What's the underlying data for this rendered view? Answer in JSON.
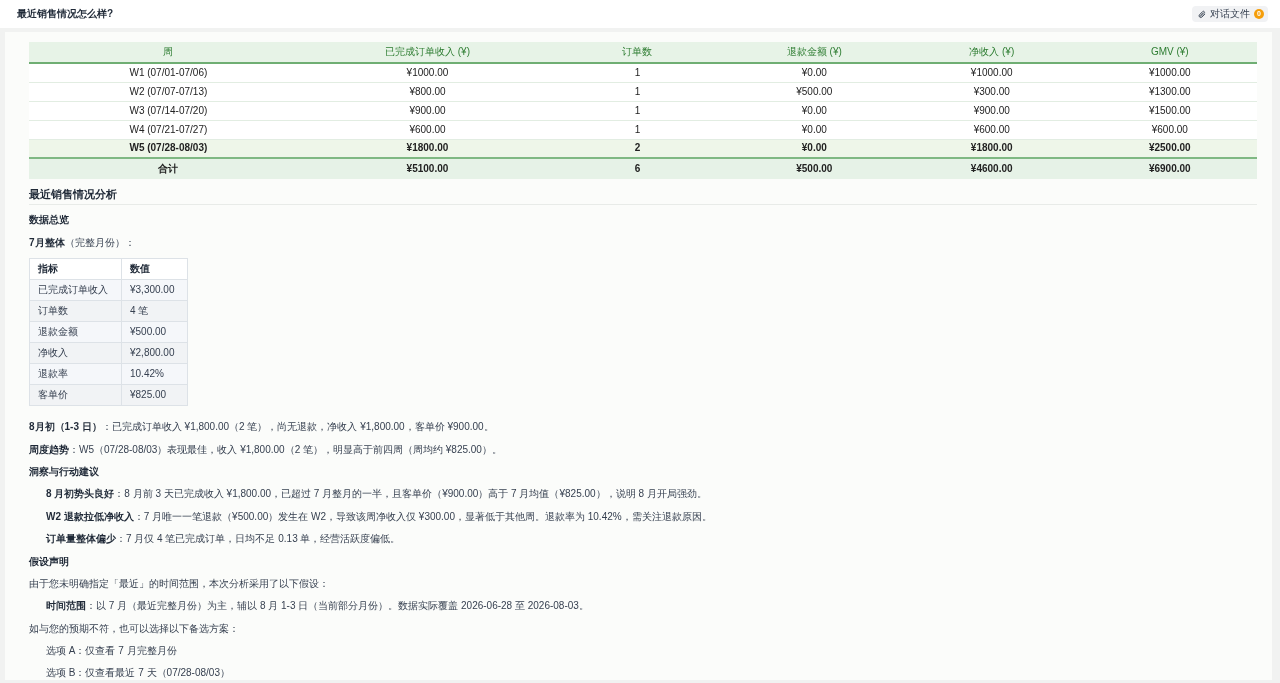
{
  "header": {
    "title": "最近销售情况怎么样?",
    "files_button": {
      "label": "对话文件",
      "count": "0"
    }
  },
  "sales_table": {
    "columns": [
      "周",
      "已完成订单收入 (¥)",
      "订单数",
      "退款金额 (¥)",
      "净收入 (¥)",
      "GMV (¥)"
    ],
    "rows": [
      {
        "kind": "week",
        "cells": [
          "W1 (07/01-07/06)",
          "¥1000.00",
          "1",
          "¥0.00",
          "¥1000.00",
          "¥1000.00"
        ]
      },
      {
        "kind": "week",
        "cells": [
          "W2 (07/07-07/13)",
          "¥800.00",
          "1",
          "¥500.00",
          "¥300.00",
          "¥1300.00"
        ]
      },
      {
        "kind": "week",
        "cells": [
          "W3 (07/14-07/20)",
          "¥900.00",
          "1",
          "¥0.00",
          "¥900.00",
          "¥1500.00"
        ]
      },
      {
        "kind": "week",
        "cells": [
          "W4 (07/21-07/27)",
          "¥600.00",
          "1",
          "¥0.00",
          "¥600.00",
          "¥600.00"
        ]
      },
      {
        "kind": "highlight",
        "cells": [
          "W5 (07/28-08/03)",
          "¥1800.00",
          "2",
          "¥0.00",
          "¥1800.00",
          "¥2500.00"
        ]
      },
      {
        "kind": "total",
        "cells": [
          "合计",
          "¥5100.00",
          "6",
          "¥500.00",
          "¥4600.00",
          "¥6900.00"
        ]
      }
    ]
  },
  "analysis": {
    "blocks": [
      {
        "kind": "title",
        "text": "最近销售情况分析"
      },
      {
        "kind": "heading",
        "text": "数据总览"
      },
      {
        "kind": "paragraph",
        "text": "**7月整体**（完整月份）："
      },
      {
        "kind": "metrics_table",
        "columns": [
          "指标",
          "数值"
        ],
        "rows": [
          [
            "已完成订单收入",
            "¥3,300.00"
          ],
          [
            "订单数",
            "4 笔"
          ],
          [
            "退款金额",
            "¥500.00"
          ],
          [
            "净收入",
            "¥2,800.00"
          ],
          [
            "退款率",
            "10.42%"
          ],
          [
            "客单价",
            "¥825.00"
          ]
        ]
      },
      {
        "kind": "paragraph",
        "text": "**8月初（1-3 日）**：已完成订单收入 ¥1,800.00（2 笔），尚无退款，净收入 ¥1,800.00，客单价 ¥900.00。"
      },
      {
        "kind": "paragraph",
        "text": "**周度趋势**：W5（07/28-08/03）表现最佳，收入 ¥1,800.00（2 笔），明显高于前四周（周均约 ¥825.00）。"
      },
      {
        "kind": "heading",
        "text": "洞察与行动建议"
      },
      {
        "kind": "indented",
        "text": "**8 月初势头良好**：8 月前 3 天已完成收入 ¥1,800.00，已超过 7 月整月的一半，且客单价（¥900.00）高于 7 月均值（¥825.00），说明 8 月开局强劲。"
      },
      {
        "kind": "indented",
        "text": "**W2 退款拉低净收入**：7 月唯一一笔退款（¥500.00）发生在 W2，导致该周净收入仅 ¥300.00，显著低于其他周。退款率为 10.42%，需关注退款原因。"
      },
      {
        "kind": "indented",
        "text": "**订单量整体偏少**：7 月仅 4 笔已完成订单，日均不足 0.13 单，经营活跃度偏低。"
      },
      {
        "kind": "heading",
        "text": "假设声明"
      },
      {
        "kind": "paragraph",
        "text": "由于您未明确指定「最近」的时间范围，本次分析采用了以下假设："
      },
      {
        "kind": "indented",
        "text": "**时间范围**：以 7 月（最近完整月份）为主，辅以 8 月 1-3 日（当前部分月份）。数据实际覆盖 2026-06-28 至 2026-08-03。"
      },
      {
        "kind": "paragraph",
        "text": "如与您的预期不符，也可以选择以下备选方案："
      },
      {
        "kind": "indented",
        "text": "选项 A：仅查看 7 月完整月份"
      },
      {
        "kind": "indented",
        "text": "选项 B：仅查看最近 7 天（07/28-08/03）"
      }
    ]
  }
}
